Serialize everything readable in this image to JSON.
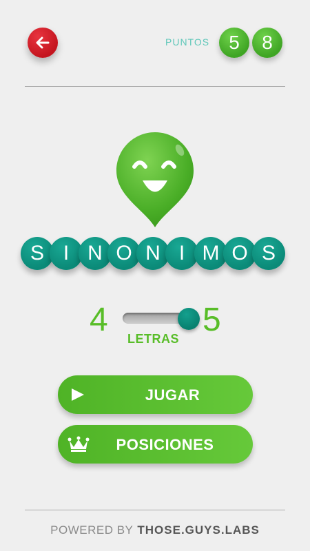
{
  "header": {
    "points_label": "PUNTOS",
    "points_digits": [
      "5",
      "8"
    ]
  },
  "logo": {
    "icon": "smiley-pin-icon",
    "title_letters": [
      "S",
      "I",
      "N",
      "O",
      "N",
      "I",
      "M",
      "O",
      "S"
    ]
  },
  "letters_selector": {
    "min": "4",
    "max": "5",
    "label": "LETRAS",
    "selected_fraction": 1.0
  },
  "buttons": {
    "play_label": "JUGAR",
    "positions_label": "POSICIONES"
  },
  "footer": {
    "powered_by": "POWERED BY",
    "brand": "THOSE.GUYS.LABS"
  },
  "colors": {
    "back_button": "#d81e28",
    "points_label": "#5fc7b9",
    "green_accent": "#58bd28",
    "teal_accent": "#0e9a86",
    "background": "#efefef"
  }
}
